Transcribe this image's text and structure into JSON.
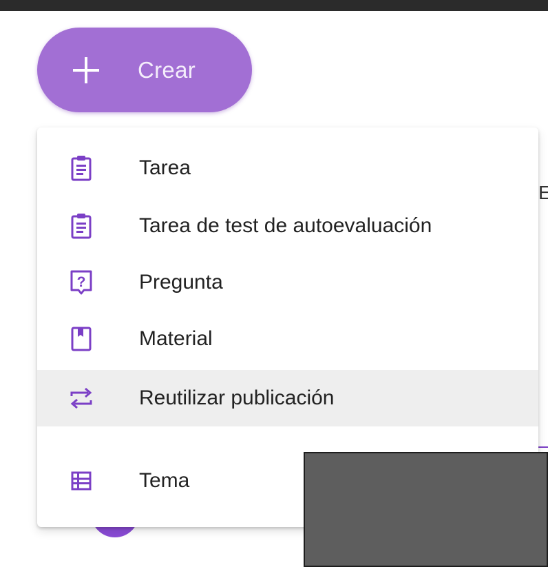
{
  "create": {
    "label": "Crear",
    "icon": "plus-icon"
  },
  "menu": {
    "items": [
      {
        "label": "Tarea",
        "icon": "assignment-icon"
      },
      {
        "label": "Tarea de test de autoevaluación",
        "icon": "quiz-assignment-icon"
      },
      {
        "label": "Pregunta",
        "icon": "question-icon"
      },
      {
        "label": "Material",
        "icon": "material-icon"
      },
      {
        "label": "Reutilizar publicación",
        "icon": "reuse-icon",
        "highlighted": true
      },
      {
        "label": "Tema",
        "icon": "topic-icon"
      }
    ]
  },
  "colors": {
    "accent": "#7b3fc6",
    "button": "#a26fd4",
    "highlight": "#eeeeee"
  }
}
